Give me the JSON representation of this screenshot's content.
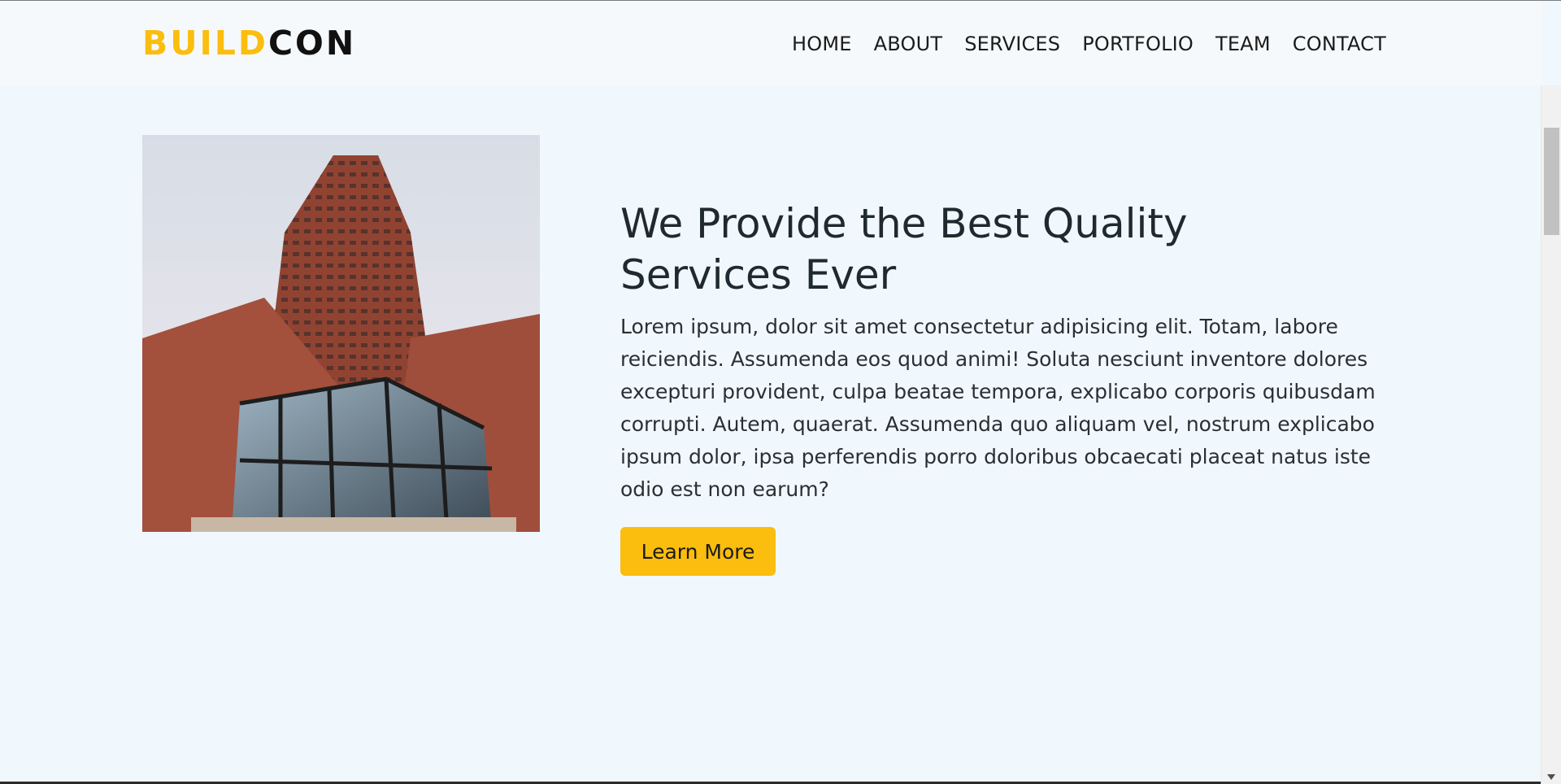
{
  "header": {
    "logo_part1": "BUILD",
    "logo_part2": "CON",
    "nav": [
      "HOME",
      "ABOUT",
      "SERVICES",
      "PORTFOLIO",
      "TEAM",
      "CONTACT"
    ]
  },
  "main": {
    "heading": "We Provide the Best Quality Services Ever",
    "paragraph": "Lorem ipsum, dolor sit amet consectetur adipisicing elit. Totam, labore reiciendis. Assumenda eos quod animi! Soluta nesciunt inventore dolores excepturi provident, culpa beatae tempora, explicabo corporis quibusdam corrupti. Autem, quaerat. Assumenda quo aliquam vel, nostrum explicabo ipsum dolor, ipsa perferendis porro doloribus obcaecati placeat natus iste odio est non earum?",
    "button_label": "Learn More"
  },
  "colors": {
    "accent": "#fbbd0e",
    "background": "#f1f8fd",
    "header_bg": "#f6f9fb",
    "text": "#212529"
  }
}
